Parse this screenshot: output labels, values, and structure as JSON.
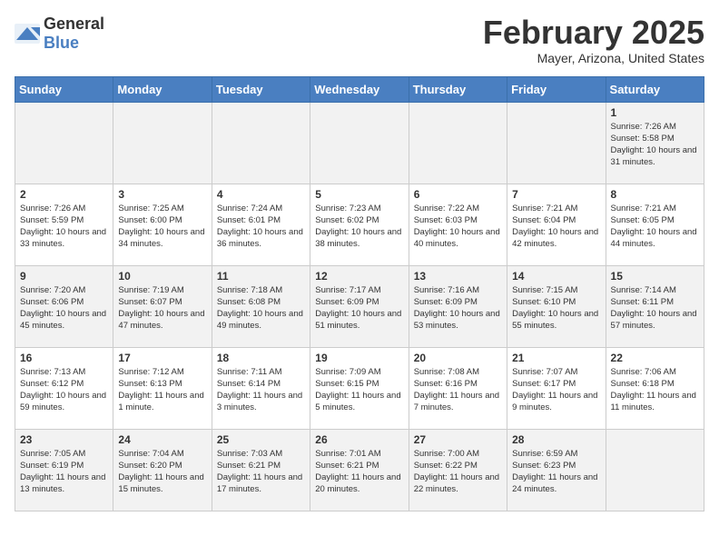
{
  "header": {
    "logo_general": "General",
    "logo_blue": "Blue",
    "month_title": "February 2025",
    "location": "Mayer, Arizona, United States"
  },
  "days_of_week": [
    "Sunday",
    "Monday",
    "Tuesday",
    "Wednesday",
    "Thursday",
    "Friday",
    "Saturday"
  ],
  "weeks": [
    [
      {
        "day": "",
        "info": ""
      },
      {
        "day": "",
        "info": ""
      },
      {
        "day": "",
        "info": ""
      },
      {
        "day": "",
        "info": ""
      },
      {
        "day": "",
        "info": ""
      },
      {
        "day": "",
        "info": ""
      },
      {
        "day": "1",
        "info": "Sunrise: 7:26 AM\nSunset: 5:58 PM\nDaylight: 10 hours and 31 minutes."
      }
    ],
    [
      {
        "day": "2",
        "info": "Sunrise: 7:26 AM\nSunset: 5:59 PM\nDaylight: 10 hours and 33 minutes."
      },
      {
        "day": "3",
        "info": "Sunrise: 7:25 AM\nSunset: 6:00 PM\nDaylight: 10 hours and 34 minutes."
      },
      {
        "day": "4",
        "info": "Sunrise: 7:24 AM\nSunset: 6:01 PM\nDaylight: 10 hours and 36 minutes."
      },
      {
        "day": "5",
        "info": "Sunrise: 7:23 AM\nSunset: 6:02 PM\nDaylight: 10 hours and 38 minutes."
      },
      {
        "day": "6",
        "info": "Sunrise: 7:22 AM\nSunset: 6:03 PM\nDaylight: 10 hours and 40 minutes."
      },
      {
        "day": "7",
        "info": "Sunrise: 7:21 AM\nSunset: 6:04 PM\nDaylight: 10 hours and 42 minutes."
      },
      {
        "day": "8",
        "info": "Sunrise: 7:21 AM\nSunset: 6:05 PM\nDaylight: 10 hours and 44 minutes."
      }
    ],
    [
      {
        "day": "9",
        "info": "Sunrise: 7:20 AM\nSunset: 6:06 PM\nDaylight: 10 hours and 45 minutes."
      },
      {
        "day": "10",
        "info": "Sunrise: 7:19 AM\nSunset: 6:07 PM\nDaylight: 10 hours and 47 minutes."
      },
      {
        "day": "11",
        "info": "Sunrise: 7:18 AM\nSunset: 6:08 PM\nDaylight: 10 hours and 49 minutes."
      },
      {
        "day": "12",
        "info": "Sunrise: 7:17 AM\nSunset: 6:09 PM\nDaylight: 10 hours and 51 minutes."
      },
      {
        "day": "13",
        "info": "Sunrise: 7:16 AM\nSunset: 6:09 PM\nDaylight: 10 hours and 53 minutes."
      },
      {
        "day": "14",
        "info": "Sunrise: 7:15 AM\nSunset: 6:10 PM\nDaylight: 10 hours and 55 minutes."
      },
      {
        "day": "15",
        "info": "Sunrise: 7:14 AM\nSunset: 6:11 PM\nDaylight: 10 hours and 57 minutes."
      }
    ],
    [
      {
        "day": "16",
        "info": "Sunrise: 7:13 AM\nSunset: 6:12 PM\nDaylight: 10 hours and 59 minutes."
      },
      {
        "day": "17",
        "info": "Sunrise: 7:12 AM\nSunset: 6:13 PM\nDaylight: 11 hours and 1 minute."
      },
      {
        "day": "18",
        "info": "Sunrise: 7:11 AM\nSunset: 6:14 PM\nDaylight: 11 hours and 3 minutes."
      },
      {
        "day": "19",
        "info": "Sunrise: 7:09 AM\nSunset: 6:15 PM\nDaylight: 11 hours and 5 minutes."
      },
      {
        "day": "20",
        "info": "Sunrise: 7:08 AM\nSunset: 6:16 PM\nDaylight: 11 hours and 7 minutes."
      },
      {
        "day": "21",
        "info": "Sunrise: 7:07 AM\nSunset: 6:17 PM\nDaylight: 11 hours and 9 minutes."
      },
      {
        "day": "22",
        "info": "Sunrise: 7:06 AM\nSunset: 6:18 PM\nDaylight: 11 hours and 11 minutes."
      }
    ],
    [
      {
        "day": "23",
        "info": "Sunrise: 7:05 AM\nSunset: 6:19 PM\nDaylight: 11 hours and 13 minutes."
      },
      {
        "day": "24",
        "info": "Sunrise: 7:04 AM\nSunset: 6:20 PM\nDaylight: 11 hours and 15 minutes."
      },
      {
        "day": "25",
        "info": "Sunrise: 7:03 AM\nSunset: 6:21 PM\nDaylight: 11 hours and 17 minutes."
      },
      {
        "day": "26",
        "info": "Sunrise: 7:01 AM\nSunset: 6:21 PM\nDaylight: 11 hours and 20 minutes."
      },
      {
        "day": "27",
        "info": "Sunrise: 7:00 AM\nSunset: 6:22 PM\nDaylight: 11 hours and 22 minutes."
      },
      {
        "day": "28",
        "info": "Sunrise: 6:59 AM\nSunset: 6:23 PM\nDaylight: 11 hours and 24 minutes."
      },
      {
        "day": "",
        "info": ""
      }
    ]
  ]
}
